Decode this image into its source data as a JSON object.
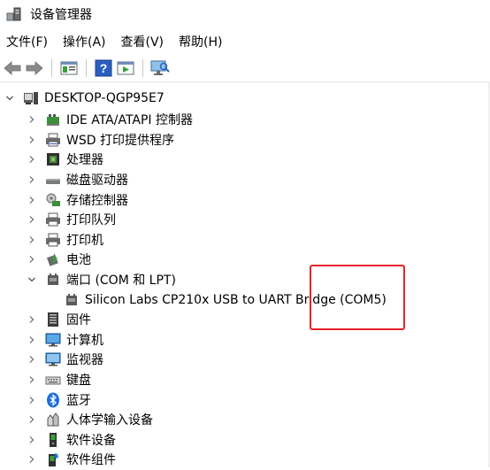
{
  "window": {
    "title": "设备管理器"
  },
  "menu": [
    {
      "label": "文件(F)"
    },
    {
      "label": "操作(A)"
    },
    {
      "label": "查看(V)"
    },
    {
      "label": "帮助(H)"
    }
  ],
  "toolbar": {
    "buttons": [
      {
        "icon": "back-arrow-icon"
      },
      {
        "icon": "forward-arrow-icon"
      },
      {
        "icon": "properties-icon"
      },
      {
        "icon": "help-icon"
      },
      {
        "icon": "run-icon"
      },
      {
        "icon": "monitor-scan-icon"
      }
    ]
  },
  "tree": {
    "root": "DESKTOP-QGP95E7",
    "categories": [
      {
        "label": "IDE ATA/ATAPI 控制器",
        "icon": "ide-controller-icon"
      },
      {
        "label": "WSD 打印提供程序",
        "icon": "printer-icon"
      },
      {
        "label": "处理器",
        "icon": "processor-icon"
      },
      {
        "label": "磁盘驱动器",
        "icon": "disk-drive-icon"
      },
      {
        "label": "存储控制器",
        "icon": "storage-controller-icon"
      },
      {
        "label": "打印队列",
        "icon": "printer-icon"
      },
      {
        "label": "打印机",
        "icon": "printer-icon"
      },
      {
        "label": "电池",
        "icon": "battery-icon"
      },
      {
        "label": "端口 (COM 和 LPT)",
        "icon": "port-icon",
        "expanded": true,
        "children": [
          {
            "label": "Silicon Labs CP210x USB to UART Bridge (COM5)",
            "icon": "port-icon"
          }
        ]
      },
      {
        "label": "固件",
        "icon": "firmware-icon"
      },
      {
        "label": "计算机",
        "icon": "computer-icon"
      },
      {
        "label": "监视器",
        "icon": "monitor-icon"
      },
      {
        "label": "键盘",
        "icon": "keyboard-icon"
      },
      {
        "label": "蓝牙",
        "icon": "bluetooth-icon"
      },
      {
        "label": "人体学输入设备",
        "icon": "hid-icon"
      },
      {
        "label": "软件设备",
        "icon": "software-device-icon"
      },
      {
        "label": "软件组件",
        "icon": "software-component-icon"
      }
    ]
  },
  "colors": {
    "highlight_box": "#e8202a",
    "accent_blue": "#1e6fd9",
    "icon_gray": "#6b6b6b"
  }
}
